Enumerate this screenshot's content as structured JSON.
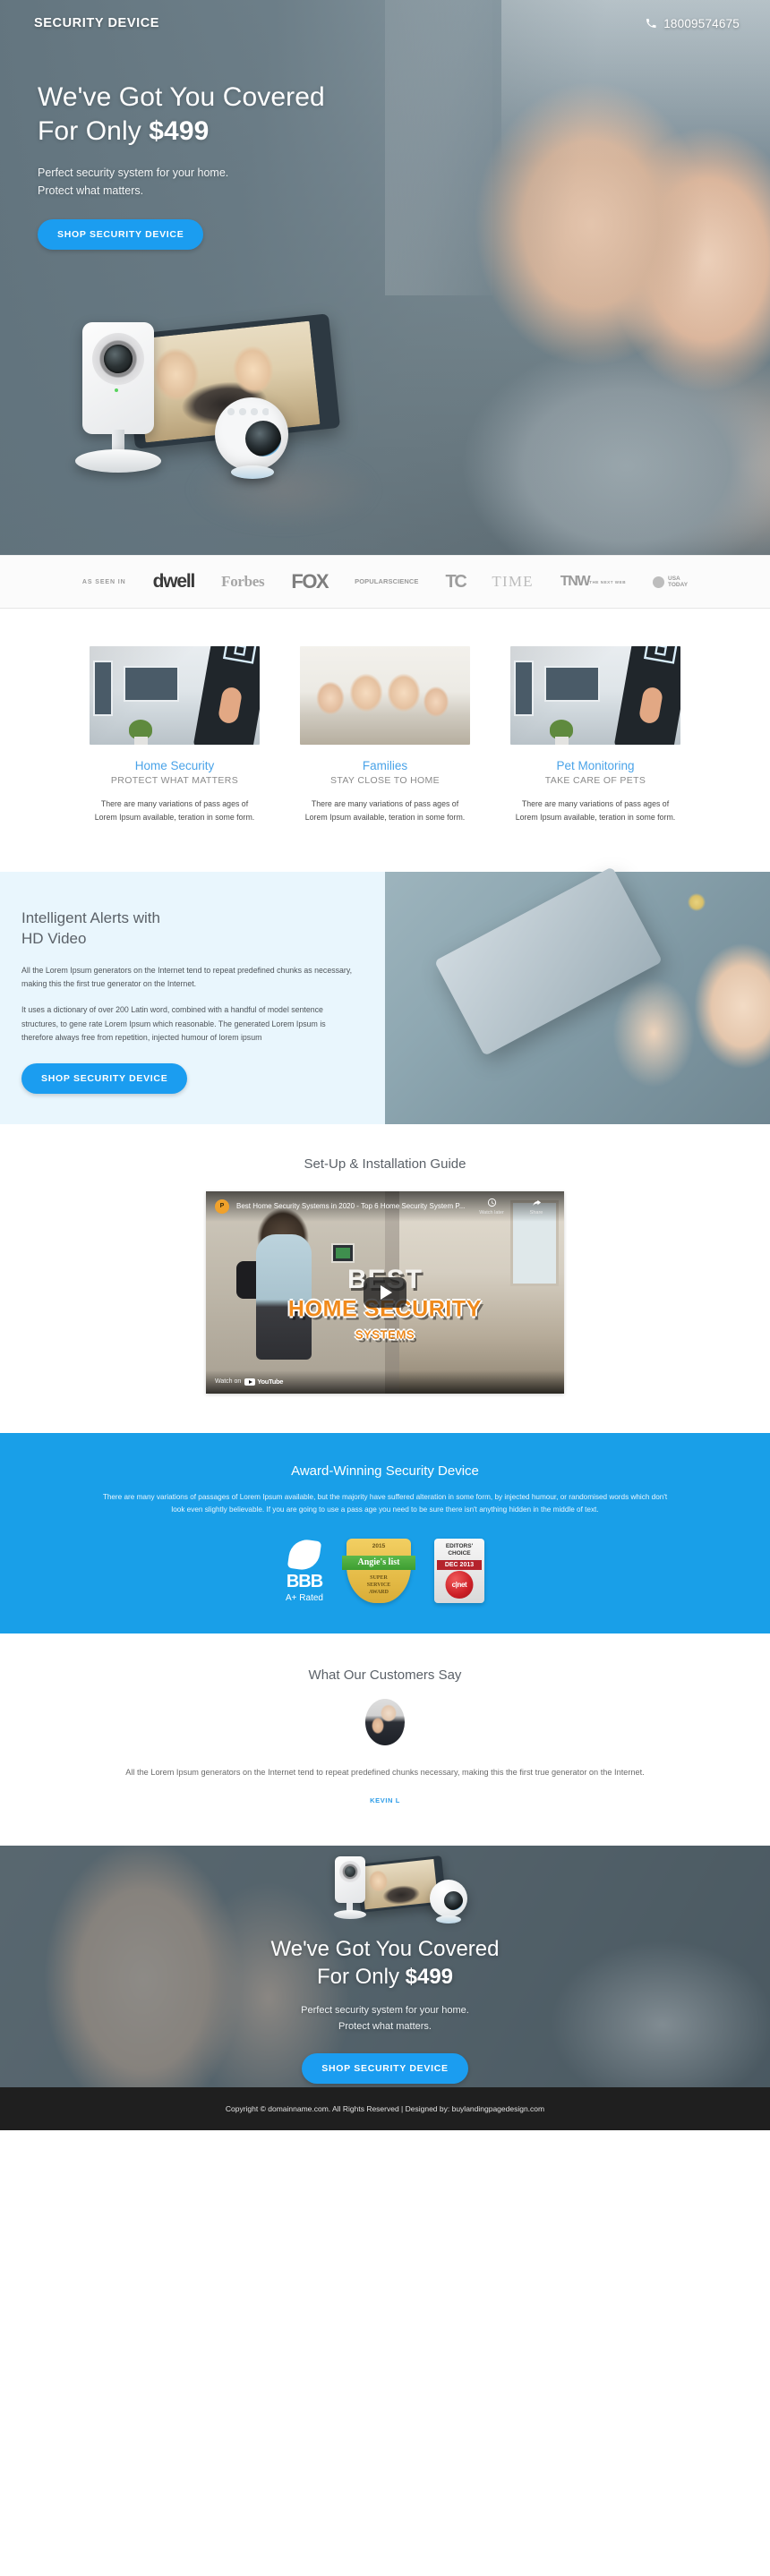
{
  "header": {
    "brand": "SECURITY DEVICE",
    "phone": "18009574675",
    "phone_icon": "phone-icon"
  },
  "hero": {
    "heading_line1": "We've Got You Covered",
    "heading_line2_prefix": "For Only ",
    "price": "$499",
    "sub_line1": "Perfect security system for your home.",
    "sub_line2": "Protect what matters.",
    "cta": "SHOP SECURITY DEVICE"
  },
  "press": {
    "label": "AS SEEN IN",
    "logos": [
      {
        "name": "dwell",
        "text": "dwell"
      },
      {
        "name": "forbes",
        "text": "Forbes"
      },
      {
        "name": "fox",
        "text": "FOX"
      },
      {
        "name": "popular-science",
        "line1": "POPULAR",
        "line2": "SCIENCE"
      },
      {
        "name": "techcrunch",
        "text": "TC"
      },
      {
        "name": "time",
        "text": "TIME"
      },
      {
        "name": "the-next-web",
        "big": "TNW",
        "small": "THE NEXT WEB"
      },
      {
        "name": "usa-today",
        "line1": "USA",
        "line2": "TODAY"
      }
    ]
  },
  "features": [
    {
      "title": "Home Security",
      "subtitle": "PROTECT WHAT MATTERS",
      "text": "There are many variations of pass ages of Lorem Ipsum available, teration in some form."
    },
    {
      "title": "Families",
      "subtitle": "STAY CLOSE TO HOME",
      "text": "There are many variations of pass ages of Lorem Ipsum available, teration in some form."
    },
    {
      "title": "Pet Monitoring",
      "subtitle": "TAKE CARE OF PETS",
      "text": "There are many variations of pass ages of Lorem Ipsum available, teration in some form."
    }
  ],
  "alerts": {
    "heading_line1": "Intelligent Alerts with",
    "heading_line2": "HD Video",
    "paragraph1": "All the Lorem Ipsum generators on the Internet tend to repeat predefined chunks as necessary, making this the first true generator on the Internet.",
    "paragraph2": "It uses a dictionary of over 200 Latin word, combined with a handful of model sentence structures, to gene rate Lorem Ipsum which reasonable. The generated Lorem Ipsum is therefore always free from repetition, injected humour of lorem ipsum",
    "cta": "SHOP SECURITY DEVICE"
  },
  "video": {
    "section_title": "Set-Up & Installation Guide",
    "yt_avatar_letter": "P",
    "yt_title": "Best Home Security Systems in 2020 - Top 6 Home Security System P...",
    "watch_later": "Watch later",
    "share": "Share",
    "watch_on": "Watch on",
    "youtube": "YouTube",
    "thumb_line1": "BEST",
    "thumb_line2": "HOME SECURITY",
    "thumb_line3_small": "SYSTEMS"
  },
  "award": {
    "heading": "Award-Winning Security Device",
    "paragraph": "There are many variations of passages of Lorem Ipsum available, but the majority have suffered alteration in some form, by injected humour, or randomised words which don't look even slightly believable. If you are going to use a pass age you need to be sure there isn't anything hidden in the middle of text.",
    "badges": [
      {
        "name": "bbb",
        "title": "BBB",
        "subtitle": "A+ Rated"
      },
      {
        "name": "angies-list",
        "year": "2015",
        "title": "Angie's list",
        "line1": "SUPER",
        "line2": "SERVICE",
        "line3": "AWARD"
      },
      {
        "name": "cnet-editors-choice",
        "line1": "EDITORS'",
        "line2": "CHOICE",
        "date": "DEC 2013",
        "brand": "c|net"
      }
    ]
  },
  "testimonial": {
    "heading": "What Our Customers Say",
    "quote": "All the Lorem Ipsum generators on the Internet tend to repeat predefined chunks necessary, making this the first true generator on the Internet.",
    "author": "KEVIN L"
  },
  "bottom_cta": {
    "heading_line1": "We've Got You Covered",
    "heading_line2_prefix": "For Only ",
    "price": "$499",
    "sub_line1": "Perfect security system for your home.",
    "sub_line2": "Protect what matters.",
    "cta": "SHOP SECURITY DEVICE"
  },
  "footer": {
    "text": "Copyright © domainname.com. All Rights Reserved | Designed by: buylandingpagedesign.com"
  },
  "colors": {
    "accent": "#199fe8",
    "cta": "#1b9df0",
    "card_title": "#4aa3e8",
    "award_bg": "#199fe8",
    "footer_bg": "#1f1f1f"
  }
}
